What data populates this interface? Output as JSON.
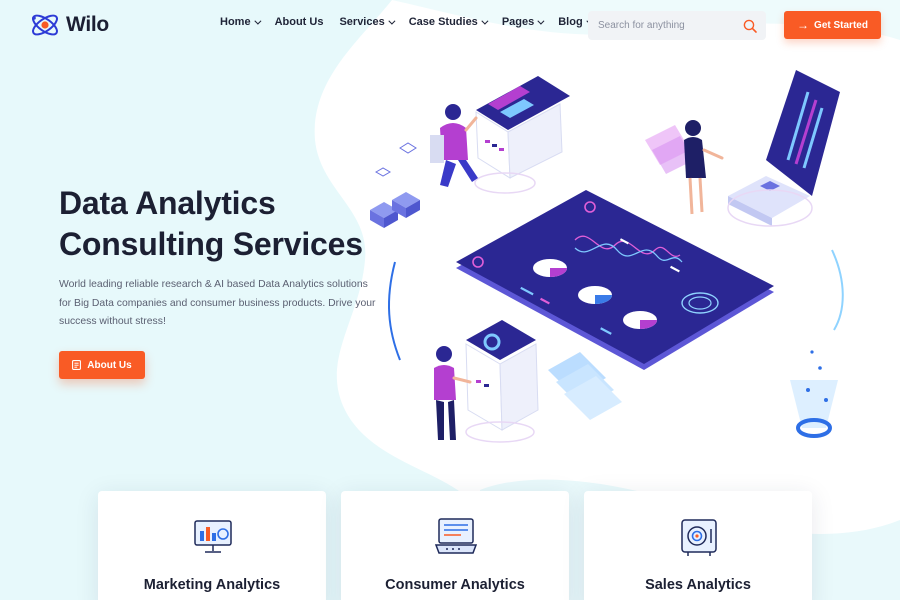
{
  "brand": {
    "name": "Wilo"
  },
  "nav": {
    "items": [
      {
        "label": "Home",
        "has_dropdown": true
      },
      {
        "label": "About Us",
        "has_dropdown": false
      },
      {
        "label": "Services",
        "has_dropdown": true
      },
      {
        "label": "Case Studies",
        "has_dropdown": true
      },
      {
        "label": "Pages",
        "has_dropdown": true
      },
      {
        "label": "Blog",
        "has_dropdown": true
      }
    ]
  },
  "search": {
    "placeholder": "Search for anything",
    "value": "",
    "icon": "search-icon"
  },
  "header_cta": {
    "label": "Get Started",
    "icon": "arrow-right-icon"
  },
  "hero": {
    "title_line1": "Data Analytics",
    "title_line2": "Consulting Services",
    "description": "World leading reliable research & AI based Data Analytics solutions for Big Data companies and consumer business products. Drive your success without stress!",
    "button_label": "About Us",
    "button_icon": "document-icon"
  },
  "services": [
    {
      "title": "Marketing Analytics",
      "icon": "marketing-dashboard-icon"
    },
    {
      "title": "Consumer Analytics",
      "icon": "consumer-laptop-icon"
    },
    {
      "title": "Sales Analytics",
      "icon": "sales-safe-icon"
    }
  ],
  "colors": {
    "accent": "#f95b25",
    "navy": "#2b2f9e",
    "bg_blob": "#e8f9fb",
    "magenta": "#b43fd0"
  }
}
